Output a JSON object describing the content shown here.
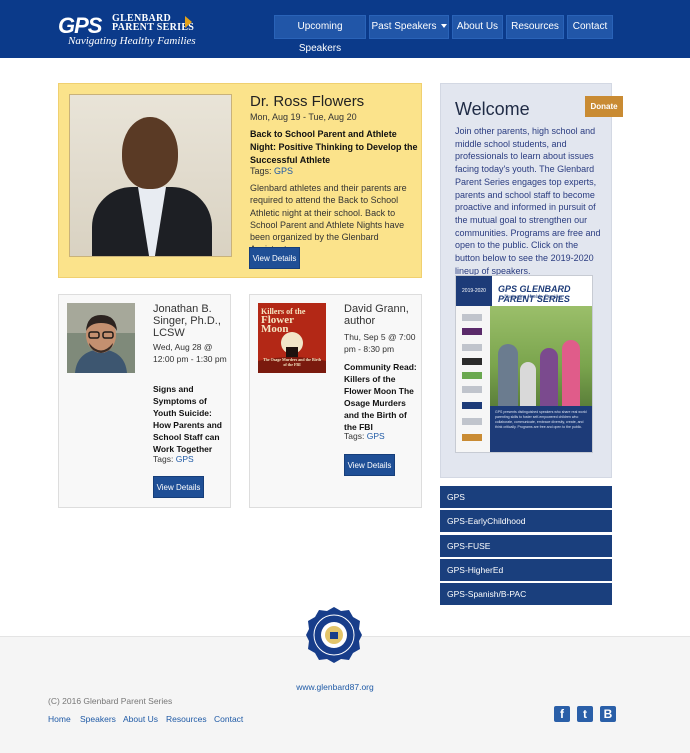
{
  "header": {
    "logo": {
      "mark": "GPS",
      "name_line1": "GLENBARD",
      "name_line2": "PARENT SERIES",
      "tagline": "Navigating Healthy Families"
    },
    "nav": [
      {
        "label": "Upcoming Speakers"
      },
      {
        "label": "Past Speakers",
        "dropdown": true
      },
      {
        "label": "About Us"
      },
      {
        "label": "Resources"
      },
      {
        "label": "Contact"
      }
    ]
  },
  "featured": {
    "name": "Dr. Ross Flowers",
    "date": "Mon, Aug 19 - Tue, Aug 20",
    "title": "Back to School Parent and Athlete Night: Positive Thinking to Develop the Successful Athlete",
    "tags_label": "Tags:",
    "tag": "GPS",
    "description": "Glenbard athletes and their parents are required to attend the Back to School Athletic night at their school. Back to School Parent and Athlete Nights have been organized by the Glenbard Assistant...",
    "button": "View Details"
  },
  "cards": [
    {
      "name": "Jonathan B. Singer, Ph.D., LCSW",
      "date": "Wed, Aug 28 @ 12:00 pm - 1:30 pm",
      "title": "Signs and Symptoms of Youth Suicide: How Parents and School Staff can Work Together",
      "tags_label": "Tags:",
      "tag": "GPS",
      "button": "View Details"
    },
    {
      "name": "David Grann, author",
      "date": "Thu, Sep 5 @ 7:00 pm - 8:30 pm",
      "title": "Community Read: Killers of the Flower Moon The Osage Murders and the Birth of the FBI",
      "tags_label": "Tags:",
      "tag": "GPS",
      "button": "View Details",
      "book_cover": {
        "line1": "Killers of the",
        "line2": "Flower",
        "line3": "Moon",
        "subtitle": "The Osage Murders and the Birth of the FBI"
      }
    }
  ],
  "sidebar": {
    "welcome_title": "Welcome",
    "donate": "Donate",
    "welcome_text": "Join other parents, high school and middle school students, and professionals to learn about issues facing today's youth. The Glenbard Parent Series engages top experts, parents and school staff to become proactive and informed in pursuit of the mutual goal to strengthen our communities. Programs are free and open to the public. Click on the button below to see the 2019-2020 lineup of speakers.",
    "poster": {
      "year": "2019-2020",
      "logo": "GPS GLENBARD PARENT SERIES",
      "tagline": "Navigating Healthy Families",
      "caption": "GPS presents distinguished speakers who share real world parenting skills to foster self-empowered children who collaborate, communicate, embrace diversity, create, and think critically. Programs are free and open to the public."
    },
    "categories": [
      "GPS",
      "GPS-EarlyChildhood",
      "GPS-FUSE",
      "GPS-HigherEd",
      "GPS-Spanish/B-PAC"
    ]
  },
  "footer": {
    "site": "www.glenbard87.org",
    "copyright": "(C) 2016 Glenbard Parent Series",
    "links": [
      "Home",
      "Speakers",
      "About Us",
      "Resources",
      "Contact"
    ],
    "social": [
      {
        "icon": "facebook-icon",
        "glyph": "f"
      },
      {
        "icon": "twitter-icon",
        "glyph": "t"
      },
      {
        "icon": "blogger-icon",
        "glyph": "B"
      }
    ]
  },
  "colors": {
    "header": "#0b3a8a",
    "nav_button": "#2156a8",
    "featured_bg": "#fbe38b",
    "button": "#1f4f96",
    "donate": "#c98b33",
    "sidebar_bg": "#e2e6ef",
    "category_bg": "#1a3f7d",
    "link": "#1f5aa6"
  }
}
